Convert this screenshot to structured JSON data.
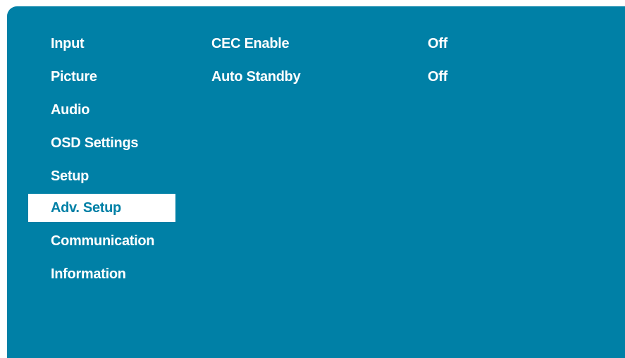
{
  "colors": {
    "panel_background": "#0080a6",
    "text": "#ffffff",
    "selection_background": "#ffffff",
    "selection_text": "#0080a6"
  },
  "menu": {
    "items": [
      {
        "label": "Input",
        "selected": false
      },
      {
        "label": "Picture",
        "selected": false
      },
      {
        "label": "Audio",
        "selected": false
      },
      {
        "label": "OSD Settings",
        "selected": false
      },
      {
        "label": "Setup",
        "selected": false
      },
      {
        "label": "Adv. Setup",
        "selected": true
      },
      {
        "label": "Communication",
        "selected": false
      },
      {
        "label": "Information",
        "selected": false
      }
    ]
  },
  "settings": {
    "rows": [
      {
        "label": "CEC Enable",
        "value": "Off"
      },
      {
        "label": "Auto Standby",
        "value": "Off"
      }
    ]
  }
}
